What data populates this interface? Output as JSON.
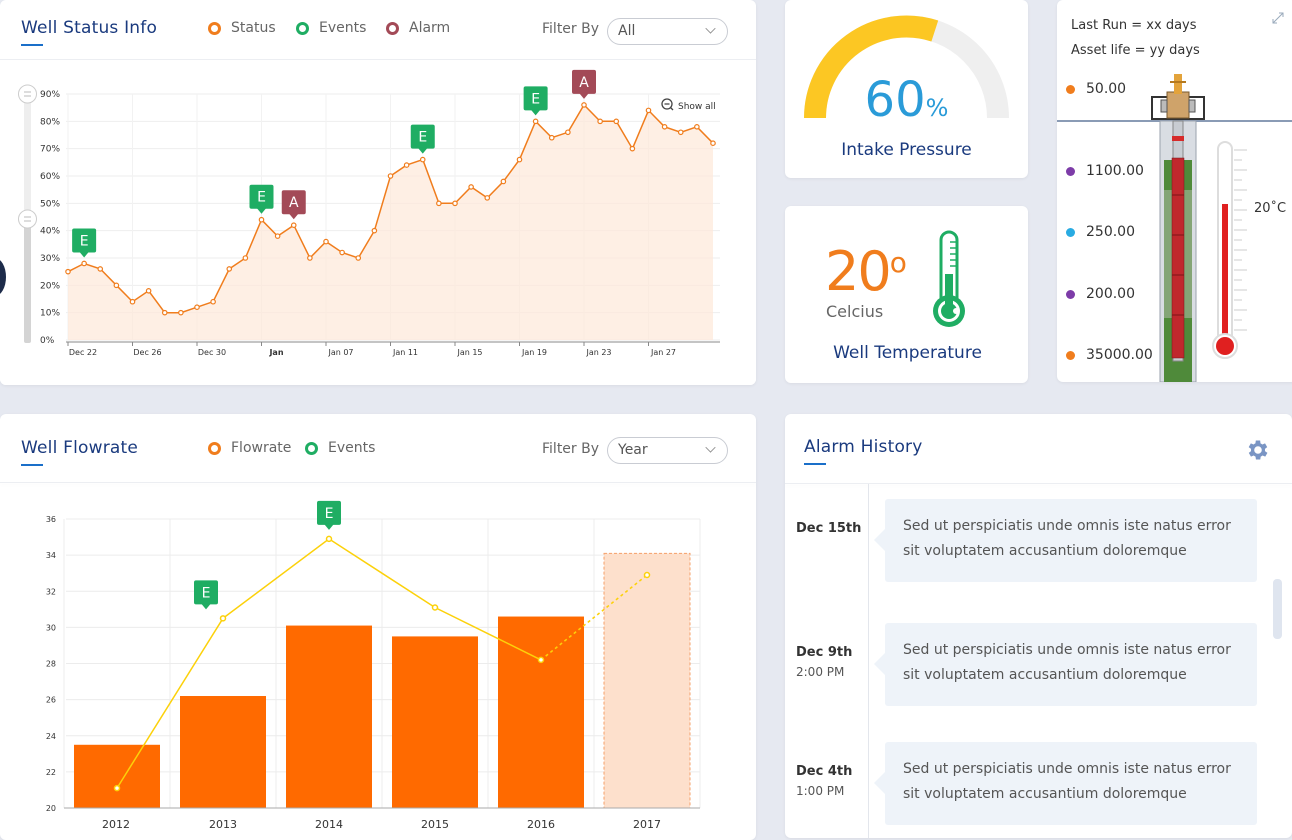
{
  "status_card": {
    "title": "Well Status Info",
    "legend": [
      {
        "label": "Status",
        "color": "#f07d1d"
      },
      {
        "label": "Events",
        "color": "#1fad63"
      },
      {
        "label": "Alarm",
        "color": "#a34a57"
      }
    ],
    "filter_label": "Filter By",
    "filter_value": "All",
    "show_all": "Show all"
  },
  "status_chart": {
    "type": "area",
    "y_ticks": [
      "0%",
      "10%",
      "20%",
      "30%",
      "40%",
      "50%",
      "60%",
      "70%",
      "80%",
      "90%"
    ],
    "x_ticks": [
      "Dec 22",
      "Dec 26",
      "Dec 30",
      "Jan",
      "Jan 07",
      "Jan 11",
      "Jan 15",
      "Jan 19",
      "Jan 23",
      "Jan 27"
    ],
    "ylim": [
      0,
      90
    ],
    "values": [
      25,
      28,
      26,
      20,
      14,
      18,
      10,
      10,
      12,
      14,
      26,
      30,
      44,
      38,
      42,
      30,
      36,
      32,
      30,
      40,
      60,
      64,
      66,
      50,
      50,
      56,
      52,
      58,
      66,
      80,
      74,
      76,
      86,
      80,
      80,
      70,
      84,
      78,
      76,
      78,
      72
    ],
    "markers": [
      {
        "label": "E",
        "type": "event",
        "index": 1
      },
      {
        "label": "E",
        "type": "event",
        "index": 12
      },
      {
        "label": "A",
        "type": "alarm",
        "index": 14
      },
      {
        "label": "E",
        "type": "event",
        "index": 22
      },
      {
        "label": "E",
        "type": "event",
        "index": 29
      },
      {
        "label": "A",
        "type": "alarm",
        "index": 32
      }
    ],
    "colors": {
      "line": "#f07d1d",
      "fill": "#fde8d9",
      "event": "#1fad63",
      "alarm": "#a34a57"
    }
  },
  "pressure": {
    "value": "60",
    "unit": "%",
    "label": "Intake Pressure",
    "fraction": 0.6,
    "color": "#fcc723",
    "text_color": "#2a9bd8"
  },
  "temperature": {
    "value": "20",
    "degree": "o",
    "unit_label": "Celcius",
    "label": "Well Temperature",
    "value_color": "#f07d1d",
    "thermo_color": "#1fad63"
  },
  "well_diagram": {
    "last_run": "Last Run = xx days",
    "asset_life": "Asset life = yy days",
    "readings": [
      {
        "value": "50.00",
        "color": "#f07d1d"
      },
      {
        "value": "1100.00",
        "color": "#7d3ca8"
      },
      {
        "value": "250.00",
        "color": "#29abe2"
      },
      {
        "value": "200.00",
        "color": "#7d3ca8"
      },
      {
        "value": "35000.00",
        "color": "#f07d1d"
      }
    ],
    "thermo_label": "20˚C"
  },
  "flow_card": {
    "title": "Well Flowrate",
    "legend": [
      {
        "label": "Flowrate",
        "color": "#f07d1d"
      },
      {
        "label": "Events",
        "color": "#1fad63"
      }
    ],
    "filter_label": "Filter By",
    "filter_value": "Year"
  },
  "flow_chart": {
    "type": "bar",
    "categories": [
      "2012",
      "2013",
      "2014",
      "2015",
      "2016",
      "2017"
    ],
    "bar_values": [
      23.5,
      26.2,
      30.1,
      29.5,
      30.6,
      34.1
    ],
    "line_values": [
      21.1,
      30.5,
      34.9,
      31.1,
      28.2,
      32.9
    ],
    "y_ticks": [
      "20",
      "22",
      "24",
      "26",
      "28",
      "30",
      "32",
      "34",
      "36"
    ],
    "ylim": [
      20,
      36
    ],
    "markers": [
      {
        "label": "E",
        "index": 1
      },
      {
        "label": "E",
        "index": 2
      }
    ],
    "colors": {
      "bar": "#ff6a00",
      "projected_bar": "#fde0cc",
      "line": "#fcd10a",
      "event": "#1fad63"
    }
  },
  "alarm_card": {
    "title": "Alarm History",
    "items": [
      {
        "date": "Dec 15th",
        "time": "",
        "text": "Sed ut perspiciatis unde omnis iste natus error sit voluptatem accusantium doloremque"
      },
      {
        "date": "Dec 9th",
        "time": "2:00 PM",
        "text": "Sed ut perspiciatis unde omnis iste natus error sit voluptatem accusantium doloremque"
      },
      {
        "date": "Dec 4th",
        "time": "1:00 PM",
        "text": "Sed ut perspiciatis unde omnis iste natus error sit voluptatem accusantium doloremque"
      }
    ]
  }
}
